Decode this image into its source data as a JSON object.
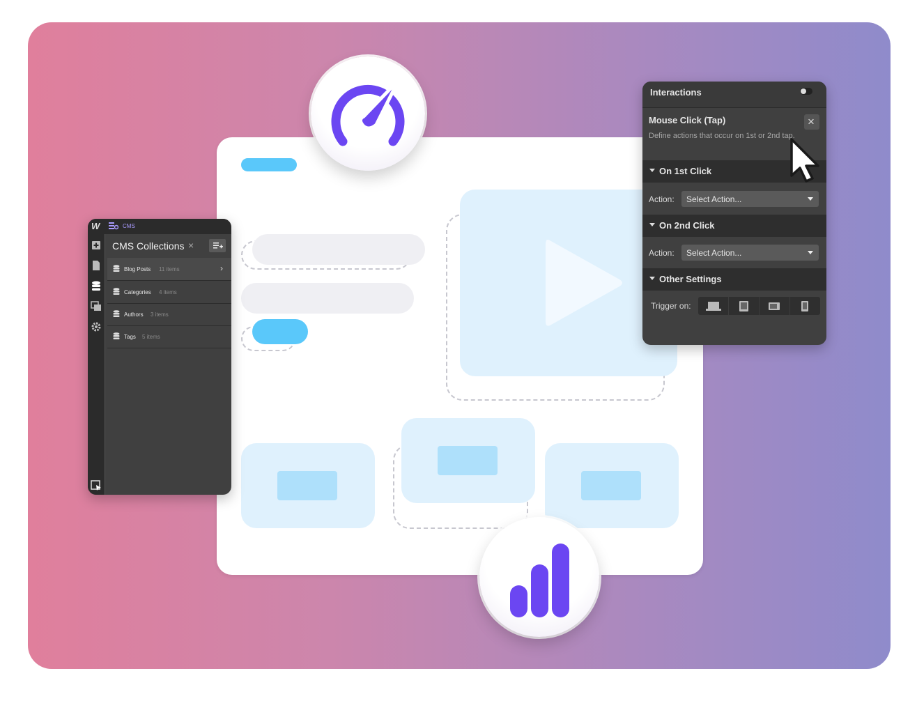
{
  "cms_panel": {
    "top_label": "CMS",
    "title": "CMS Collections",
    "collections": [
      {
        "name": "Blog Posts",
        "count": "11 items"
      },
      {
        "name": "Categories",
        "count": "4 items"
      },
      {
        "name": "Authors",
        "count": "3 items"
      },
      {
        "name": "Tags",
        "count": "5 items"
      }
    ]
  },
  "interactions_panel": {
    "title": "Interactions",
    "trigger_title": "Mouse Click (Tap)",
    "description": "Define actions that occur on 1st or 2nd tap.",
    "section_1": "On 1st Click",
    "section_2": "On 2nd Click",
    "section_3": "Other Settings",
    "action_label": "Action:",
    "action_placeholder": "Select Action...",
    "trigger_on_label": "Trigger on:"
  },
  "colors": {
    "accent_purple": "#6b46f2",
    "accent_blue": "#5ac8fa",
    "light_blue": "#dff1fd"
  }
}
